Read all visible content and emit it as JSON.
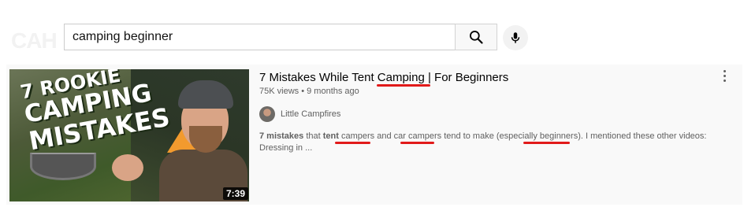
{
  "search": {
    "value": "camping beginner"
  },
  "result": {
    "title_pre": "7 Mistakes While Tent ",
    "title_hl": "Camping",
    "title_post": " | For Beginners",
    "views": "75K views",
    "sep": "•",
    "age": "9 months ago",
    "channel_name": "Little Campfires",
    "duration": "7:39",
    "thumbnail_text": [
      "7 ROOKIE",
      "CAMPING",
      "MISTAKES"
    ],
    "desc": {
      "p1": "7 mistakes",
      "p2": " that ",
      "p3": "tent",
      "p4": " ",
      "p5": "campers",
      "p6": " and car ",
      "p7": "campers",
      "p8": " tend to make (especially ",
      "p9": "beginners",
      "p10": "). I mentioned these other videos: Dressing in ..."
    }
  },
  "icons": {
    "search": "search-icon",
    "mic": "microphone-icon",
    "more": "more-vertical-icon"
  },
  "colors": {
    "annotation": "#e11a1a"
  }
}
